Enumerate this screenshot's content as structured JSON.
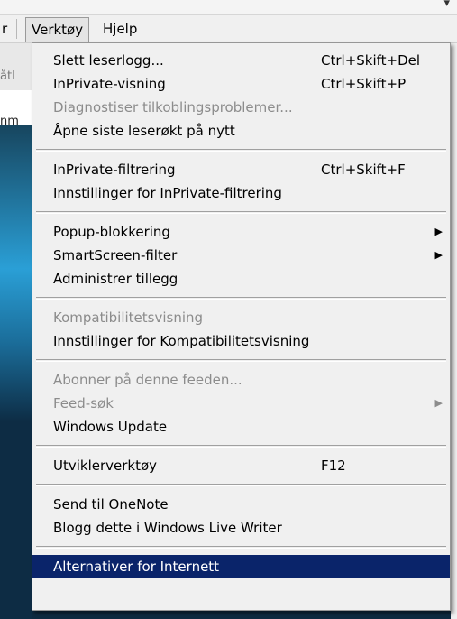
{
  "menubar": {
    "fragment": "r",
    "verktoy": "Verktøy",
    "hjelp": "Hjelp"
  },
  "background": {
    "left_text_1": "åtl",
    "left_text_2": "nm",
    "top_arrow": "▾"
  },
  "menu": {
    "items": [
      {
        "label": "Slett leserlogg...",
        "shortcut": "Ctrl+Skift+Del"
      },
      {
        "label": "InPrivate-visning",
        "shortcut": "Ctrl+Skift+P"
      },
      {
        "label": "Diagnostiser tilkoblingsproblemer...",
        "disabled": true
      },
      {
        "label": "Åpne siste leserøkt på nytt"
      },
      {
        "label": "InPrivate-filtrering",
        "shortcut": "Ctrl+Skift+F"
      },
      {
        "label": "Innstillinger for InPrivate-filtrering"
      },
      {
        "label": "Popup-blokkering",
        "submenu": true
      },
      {
        "label": "SmartScreen-filter",
        "submenu": true
      },
      {
        "label": "Administrer tillegg"
      },
      {
        "label": "Kompatibilitetsvisning",
        "disabled": true
      },
      {
        "label": "Innstillinger for Kompatibilitetsvisning"
      },
      {
        "label": "Abonner på denne feeden...",
        "disabled": true
      },
      {
        "label": "Feed-søk",
        "disabled": true,
        "submenu": true
      },
      {
        "label": "Windows Update"
      },
      {
        "label": "Utviklerverktøy",
        "shortcut": "F12"
      },
      {
        "label": "Send til OneNote"
      },
      {
        "label": "Blogg dette i Windows Live Writer"
      },
      {
        "label": "Alternativer for Internett",
        "selected": true
      }
    ],
    "submenu_arrow": "▶"
  }
}
